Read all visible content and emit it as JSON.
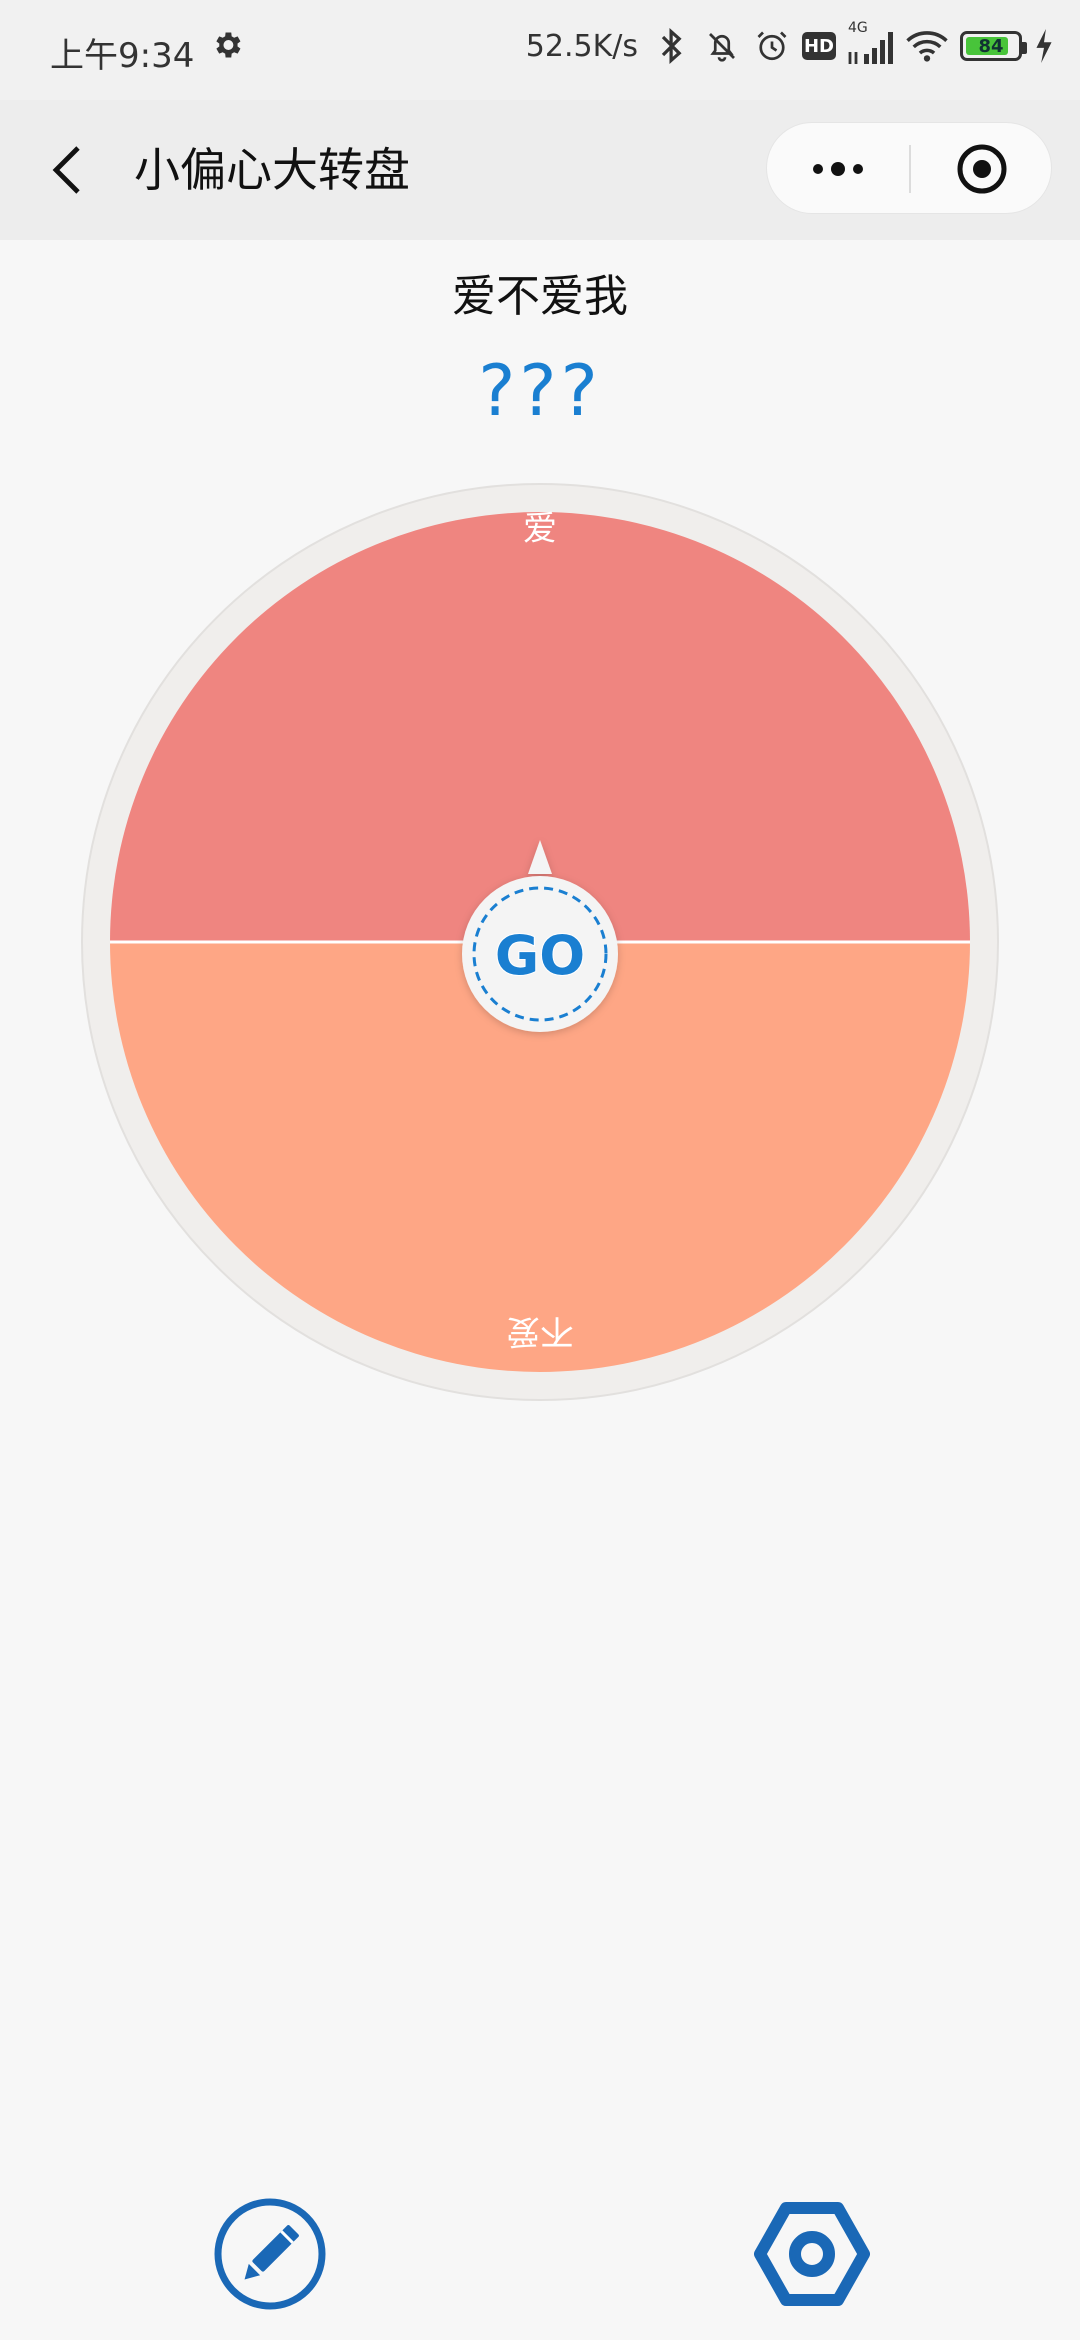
{
  "status_bar": {
    "time": "上午9:34",
    "net_speed": "52.5K/s",
    "signal_type": "4G",
    "hd_label": "HD",
    "battery": "84",
    "battery_level": 0.84,
    "icons": [
      "gear-icon",
      "bluetooth-icon",
      "mute-bell-icon",
      "alarm-icon",
      "hd-icon",
      "signal-icon",
      "wifi-icon",
      "battery-icon",
      "charging-icon"
    ]
  },
  "nav": {
    "title": "小偏心大转盘",
    "back_icon": "chevron-left-icon",
    "more_icon": "more-dots-icon",
    "close_icon": "target-close-icon"
  },
  "main": {
    "question": "爱不爱我",
    "result": "???"
  },
  "wheel": {
    "go_label": "GO",
    "segments": [
      {
        "label": "爱",
        "color": "#ef8580"
      },
      {
        "label": "不爱",
        "color": "#fea685"
      }
    ],
    "accent": "#1a7fd1"
  },
  "bottom": {
    "edit_icon": "pencil-icon",
    "settings_icon": "hexagon-settings-icon"
  }
}
